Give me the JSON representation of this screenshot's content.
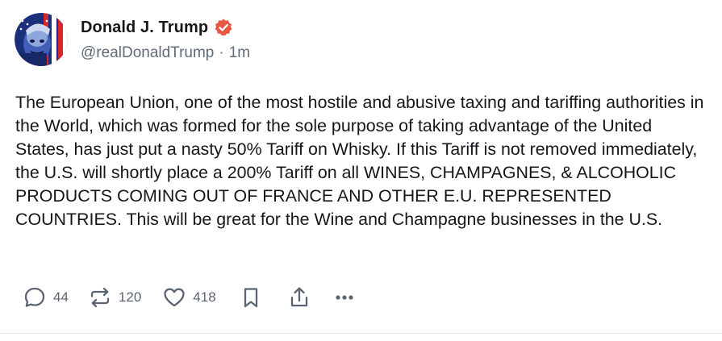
{
  "post": {
    "author": {
      "display_name": "Donald J. Trump",
      "handle": "@realDonaldTrump",
      "separator": "·",
      "timestamp": "1m",
      "avatar_icon": "avatar-flag-portrait",
      "verified_icon": "verified-badge-icon",
      "verified_color": "#e8573f"
    },
    "text": "The European Union, one of the most hostile and abusive taxing and tariffing authorities in the World, which was formed for the sole purpose of taking advantage of the United States, has just put a nasty 50% Tariff on Whisky. If this Tariff is not removed immediately, the U.S. will shortly place a 200% Tariff on all WINES, CHAMPAGNES, & ALCOHOLIC PRODUCTS COMING OUT OF FRANCE AND OTHER E.U. REPRESENTED COUNTRIES. This will be great for the Wine and Champagne businesses in the U.S.",
    "actions": {
      "replies": {
        "icon": "reply-icon",
        "count": "44"
      },
      "retruths": {
        "icon": "retruth-icon",
        "count": "120"
      },
      "likes": {
        "icon": "heart-icon",
        "count": "418"
      },
      "bookmark": {
        "icon": "bookmark-icon"
      },
      "share": {
        "icon": "share-icon"
      },
      "more": {
        "icon": "more-icon"
      }
    }
  }
}
